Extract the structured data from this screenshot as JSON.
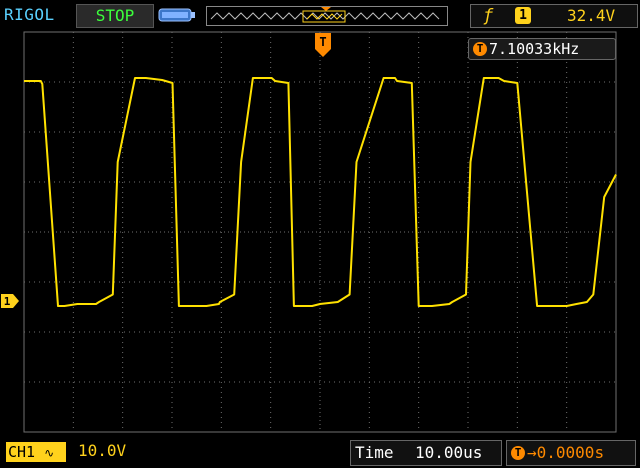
{
  "header": {
    "brand": "RIGOL",
    "run_state": "STOP",
    "trigger": {
      "slope_icon": "rising-edge-icon",
      "source": "1",
      "level": "32.4V"
    }
  },
  "measurement": {
    "trigger_icon": "T",
    "frequency": "7.10033kHz"
  },
  "markers": {
    "trigger_position": "T",
    "channel": "1"
  },
  "footer": {
    "channel_label": "CH1",
    "coupling_icon": "ac-coupling-icon",
    "volts_per_div": "10.0V",
    "time_label": "Time",
    "time_per_div": "10.00us",
    "offset_icon": "T",
    "trigger_offset": "0.0000s"
  },
  "colors": {
    "trace": "#ffe100",
    "grid": "#6f6f6f",
    "accent": "#ff8a00",
    "label": "#ffd21c"
  },
  "chart_data": {
    "type": "line",
    "title": "",
    "xlabel": "",
    "ylabel": "",
    "x_unit": "us",
    "y_unit": "V",
    "xlim": [
      -60,
      60
    ],
    "ylim": [
      -40,
      40
    ],
    "grid": true,
    "series": [
      {
        "x": [
          -60,
          -56.6,
          -56.3,
          -53.1,
          -51.8,
          -49.2,
          -45.4,
          -44.8,
          -42.0,
          -41.0,
          -37.5,
          -35.3,
          -32.0,
          -29.9,
          -28.6,
          -23.0,
          -20.5,
          -20.3,
          -17.4,
          -16.0,
          -13.6,
          -9.8,
          -9.1,
          -6.4,
          -5.3,
          -1.6,
          0.0,
          3.6,
          6.0,
          7.4,
          12.9,
          15.2,
          15.6,
          18.6,
          20.0,
          22.7,
          26.2,
          26.8,
          29.6,
          30.5,
          33.2,
          36.2,
          37.3,
          40.0,
          44.0,
          50.0,
          52.0,
          54.1,
          55.4,
          57.6,
          60.0
        ],
        "y": [
          30.2,
          30.2,
          29.6,
          -14.8,
          -14.8,
          -14.4,
          -14.4,
          -14.0,
          -12.5,
          14.0,
          30.8,
          30.8,
          30.4,
          29.8,
          -14.8,
          -14.8,
          -14.4,
          -14.0,
          -12.5,
          14.0,
          30.8,
          30.8,
          30.2,
          29.8,
          -14.8,
          -14.8,
          -14.4,
          -14.0,
          -12.5,
          14.0,
          30.8,
          30.8,
          30.2,
          29.8,
          -14.8,
          -14.8,
          -14.4,
          -14.0,
          -12.5,
          14.0,
          30.8,
          30.8,
          30.2,
          29.8,
          -14.8,
          -14.8,
          -14.4,
          -14.0,
          -12.5,
          7.0,
          11.5
        ]
      }
    ]
  }
}
